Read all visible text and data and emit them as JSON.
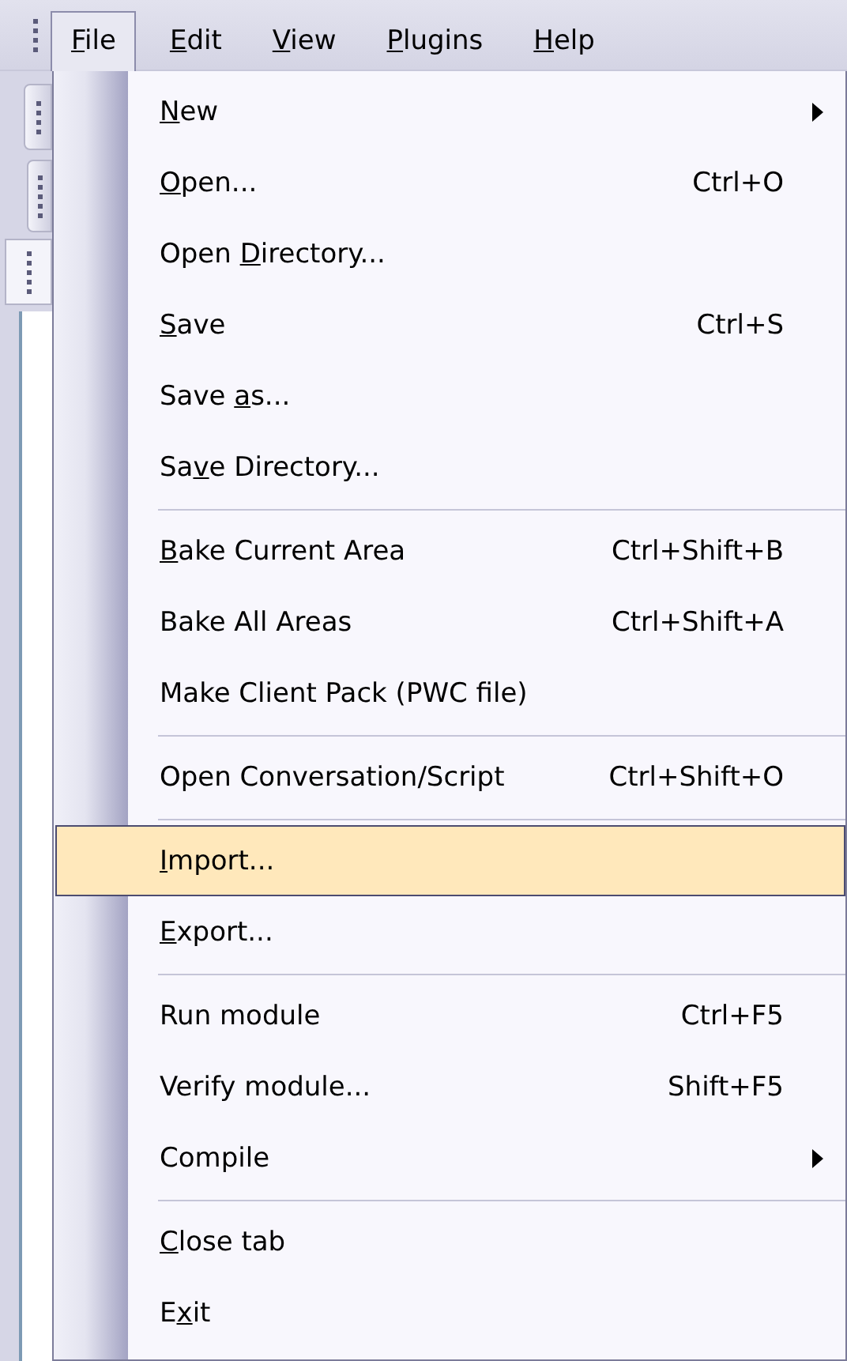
{
  "menubar": {
    "items": [
      {
        "label_parts": {
          "key": "F",
          "after": "ile"
        },
        "selected": true
      },
      {
        "label_parts": {
          "key": "E",
          "after": "dit"
        },
        "selected": false
      },
      {
        "label_parts": {
          "key": "V",
          "after": "iew"
        },
        "selected": false
      },
      {
        "label_parts": {
          "key": "P",
          "after": "lugins"
        },
        "selected": false
      },
      {
        "label_parts": {
          "key": "H",
          "after": "elp"
        },
        "selected": false
      }
    ]
  },
  "menu": {
    "groups": [
      [
        {
          "label_parts": {
            "key": "N",
            "after": "ew"
          },
          "submenu": true,
          "selected": false
        },
        {
          "label_parts": {
            "key": "O",
            "after": "pen..."
          },
          "shortcut": "Ctrl+O",
          "submenu": false,
          "selected": false
        },
        {
          "label_parts": {
            "before": "Open ",
            "key": "D",
            "after": "irectory..."
          },
          "submenu": false,
          "selected": false
        },
        {
          "label_parts": {
            "key": "S",
            "after": "ave"
          },
          "shortcut": "Ctrl+S",
          "submenu": false,
          "selected": false
        },
        {
          "label_parts": {
            "before": "Save ",
            "key": "a",
            "after": "s..."
          },
          "submenu": false,
          "selected": false
        },
        {
          "label_parts": {
            "before": "Sa",
            "key": "v",
            "after": "e Directory..."
          },
          "submenu": false,
          "selected": false
        }
      ],
      [
        {
          "label_parts": {
            "key": "B",
            "after": "ake Current Area"
          },
          "shortcut": "Ctrl+Shift+B",
          "submenu": false,
          "selected": false
        },
        {
          "label": "Bake All Areas",
          "shortcut": "Ctrl+Shift+A",
          "submenu": false,
          "selected": false
        },
        {
          "label": "Make Client Pack (PWC file)",
          "submenu": false,
          "selected": false
        }
      ],
      [
        {
          "label": "Open Conversation/Script",
          "shortcut": "Ctrl+Shift+O",
          "submenu": false,
          "selected": false
        }
      ],
      [
        {
          "label_parts": {
            "key": "I",
            "after": "mport..."
          },
          "submenu": false,
          "selected": true
        },
        {
          "label_parts": {
            "key": "E",
            "after": "xport..."
          },
          "submenu": false,
          "selected": false
        }
      ],
      [
        {
          "label": "Run module",
          "shortcut": "Ctrl+F5",
          "submenu": false,
          "selected": false
        },
        {
          "label": "Verify module...",
          "shortcut": "Shift+F5",
          "submenu": false,
          "selected": false
        },
        {
          "label": "Compile",
          "submenu": true,
          "selected": false
        }
      ],
      [
        {
          "label_parts": {
            "key": "C",
            "after": "lose tab"
          },
          "submenu": false,
          "selected": false
        },
        {
          "label_parts": {
            "before": "E",
            "key": "x",
            "after": "it"
          },
          "submenu": false,
          "selected": false
        }
      ]
    ]
  }
}
